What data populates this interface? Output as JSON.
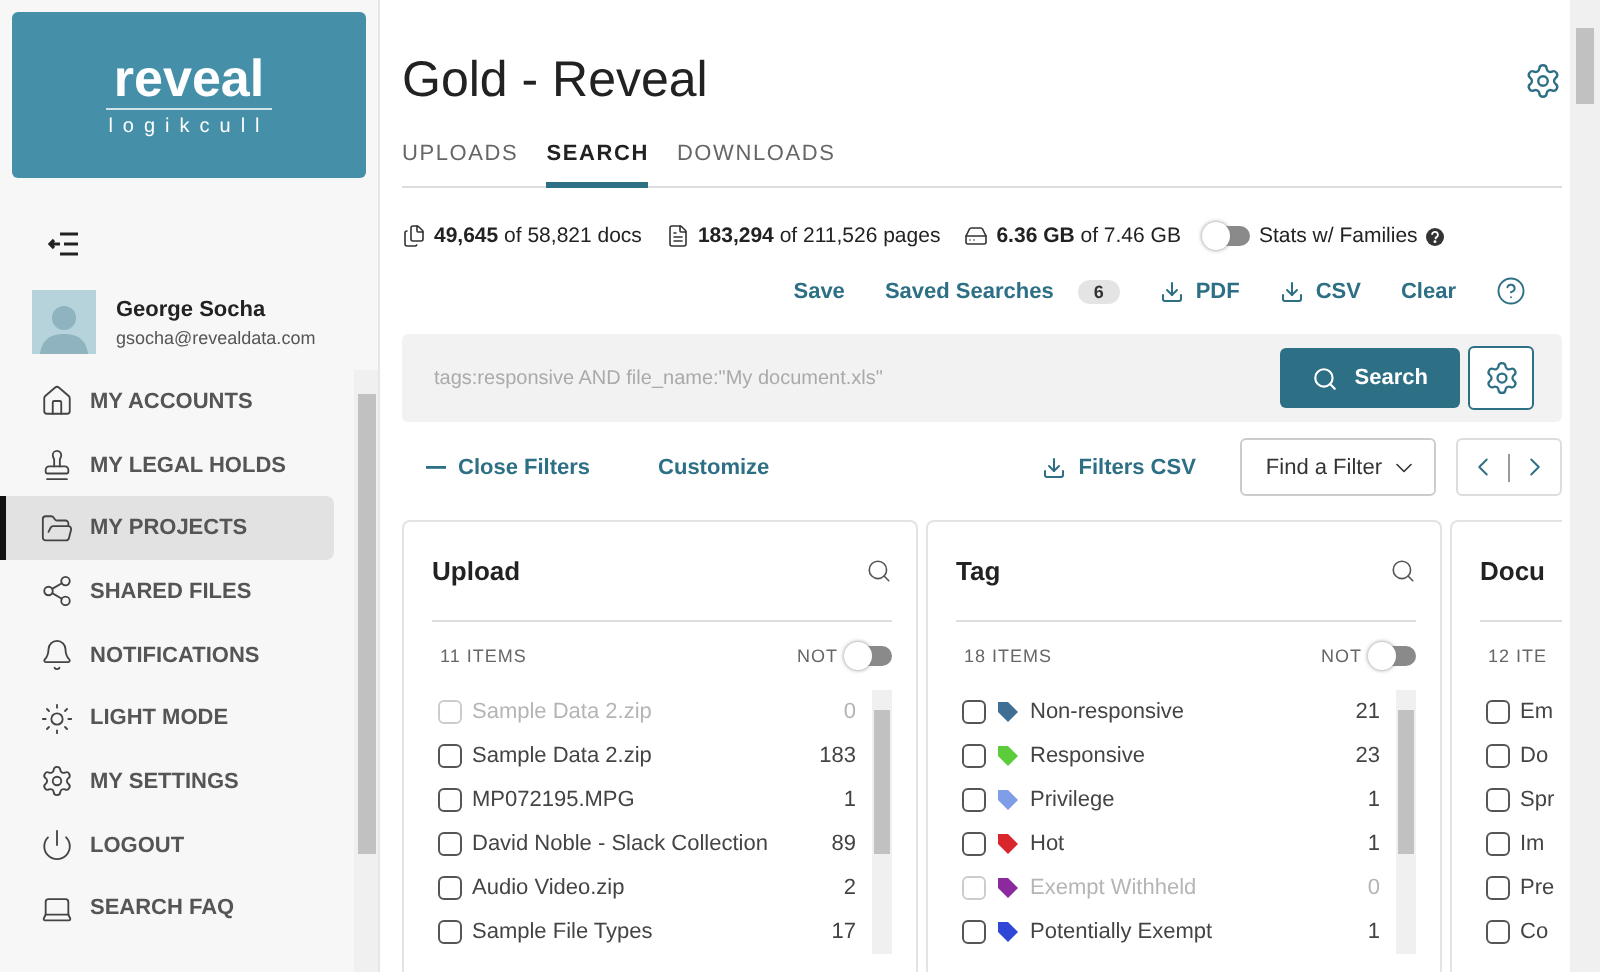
{
  "logo": {
    "name": "reveal",
    "sub": "logikcull"
  },
  "user": {
    "name": "George Socha",
    "email": "gsocha@revealdata.com"
  },
  "nav": [
    {
      "label": "MY ACCOUNTS",
      "selected": false
    },
    {
      "label": "MY LEGAL HOLDS",
      "selected": false
    },
    {
      "label": "MY PROJECTS",
      "selected": true
    },
    {
      "label": "SHARED FILES",
      "selected": false
    },
    {
      "label": "NOTIFICATIONS",
      "selected": false
    },
    {
      "label": "LIGHT MODE",
      "selected": false
    },
    {
      "label": "MY SETTINGS",
      "selected": false
    },
    {
      "label": "LOGOUT",
      "selected": false
    },
    {
      "label": "SEARCH FAQ",
      "selected": false
    }
  ],
  "title": "Gold - Reveal",
  "tabs": [
    {
      "label": "UPLOADS",
      "selected": false
    },
    {
      "label": "SEARCH",
      "selected": true
    },
    {
      "label": "DOWNLOADS",
      "selected": false
    }
  ],
  "stats": [
    {
      "value": "49,645",
      "rest": "of 58,821 docs"
    },
    {
      "value": "183,294",
      "rest": "of 211,526 pages"
    },
    {
      "value": "6.36 GB",
      "rest": "of 7.46 GB"
    }
  ],
  "families_toggle": {
    "label": "Stats w/ Families",
    "on": false
  },
  "actions": {
    "save": "Save",
    "saved_searches": "Saved Searches",
    "saved_count": "6",
    "pdf": "PDF",
    "csv": "CSV",
    "clear": "Clear"
  },
  "search": {
    "placeholder": "tags:responsive AND file_name:\"My document.xls\"",
    "button": "Search"
  },
  "filter_bar": {
    "close": "Close Filters",
    "customize": "Customize",
    "filters_csv": "Filters CSV",
    "find": "Find a Filter"
  },
  "panels": [
    {
      "title": "Upload",
      "count": "11 ITEMS",
      "not_label": "NOT",
      "not_on": false,
      "items": [
        {
          "label": "Sample Data 2.zip",
          "count": "0",
          "disabled": true,
          "checked": false
        },
        {
          "label": "Sample Data 2.zip",
          "count": "183",
          "disabled": false,
          "checked": false
        },
        {
          "label": "MP072195.MPG",
          "count": "1",
          "disabled": false,
          "checked": false
        },
        {
          "label": "David Noble - Slack Collection",
          "count": "89",
          "disabled": false,
          "checked": false
        },
        {
          "label": "Audio Video.zip",
          "count": "2",
          "disabled": false,
          "checked": false
        },
        {
          "label": "Sample File Types",
          "count": "17",
          "disabled": false,
          "checked": false
        }
      ]
    },
    {
      "title": "Tag",
      "count": "18 ITEMS",
      "not_label": "NOT",
      "not_on": false,
      "items": [
        {
          "label": "Non-responsive",
          "count": "21",
          "disabled": false,
          "checked": false,
          "color": "#3f6f94"
        },
        {
          "label": "Responsive",
          "count": "23",
          "disabled": false,
          "checked": false,
          "color": "#5ccc3c"
        },
        {
          "label": "Privilege",
          "count": "1",
          "disabled": false,
          "checked": false,
          "color": "#7f9ee8"
        },
        {
          "label": "Hot",
          "count": "1",
          "disabled": false,
          "checked": false,
          "color": "#d8262c"
        },
        {
          "label": "Exempt Withheld",
          "count": "0",
          "disabled": true,
          "checked": false,
          "color": "#8a2a9c"
        },
        {
          "label": "Potentially Exempt",
          "count": "1",
          "disabled": false,
          "checked": false,
          "color": "#2f46d6"
        }
      ]
    },
    {
      "title": "Docu",
      "count": "12 ITE",
      "items": [
        {
          "label": "Em",
          "disabled": false,
          "checked": false
        },
        {
          "label": "Do",
          "disabled": false,
          "checked": false
        },
        {
          "label": "Spr",
          "disabled": false,
          "checked": false
        },
        {
          "label": "Im",
          "disabled": false,
          "checked": false
        },
        {
          "label": "Pre",
          "disabled": false,
          "checked": false
        },
        {
          "label": "Co",
          "disabled": false,
          "checked": false
        }
      ]
    }
  ]
}
